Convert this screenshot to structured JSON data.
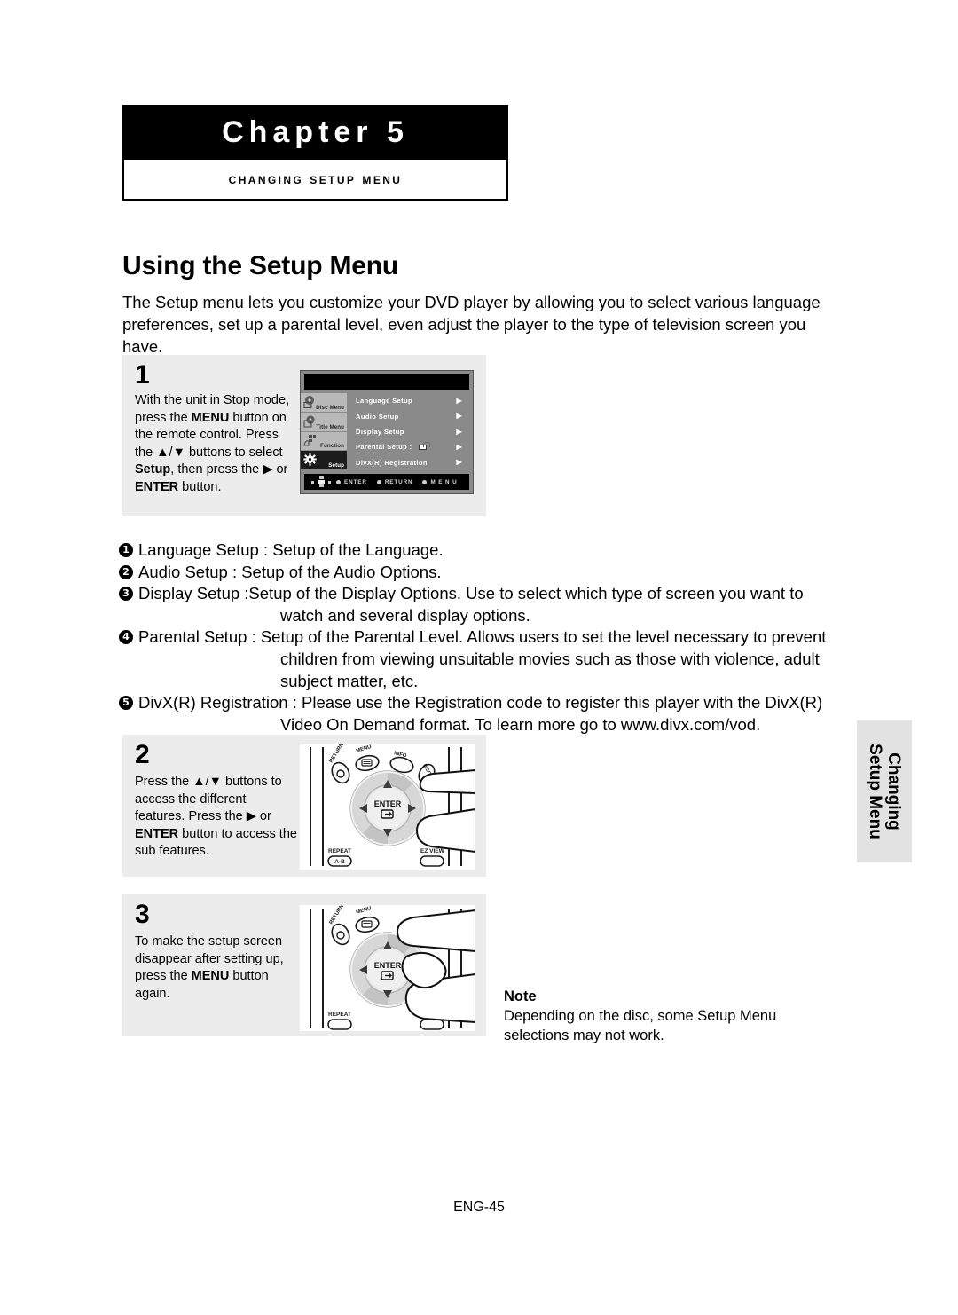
{
  "chapter": {
    "heading": "Chapter 5",
    "subheading": "Changing Setup Menu"
  },
  "page": {
    "title": "Using the Setup Menu",
    "intro": "The Setup menu lets you customize your DVD player by allowing you to select various language preferences, set up a parental level, even adjust the player to the type of television screen you have.",
    "footer": "ENG-45",
    "side_tab": "Changing\nSetup Menu"
  },
  "steps": [
    {
      "number": "1",
      "text_parts": [
        {
          "t": "With the unit in Stop mode, press the ",
          "b": false
        },
        {
          "t": "MENU",
          "b": true
        },
        {
          "t": " button on the remote control.",
          "b": false
        },
        {
          "t": "\nPress the ▲/▼ buttons to select ",
          "b": false
        },
        {
          "t": "Setup",
          "b": true
        },
        {
          "t": ", then press the ▶ or ",
          "b": false
        },
        {
          "t": "ENTER",
          "b": true
        },
        {
          "t": " button.",
          "b": false
        }
      ]
    },
    {
      "number": "2",
      "text_parts": [
        {
          "t": "Press the ▲/▼ buttons to access the different features. Press the ▶ or ",
          "b": false
        },
        {
          "t": "ENTER",
          "b": true
        },
        {
          "t": " button to access the sub features.",
          "b": false
        }
      ]
    },
    {
      "number": "3",
      "text_parts": [
        {
          "t": "To make the setup screen disappear after setting up, press the ",
          "b": false
        },
        {
          "t": "MENU",
          "b": true
        },
        {
          "t": " button again.",
          "b": false
        }
      ]
    }
  ],
  "osd": {
    "sidebar": [
      {
        "label": "Disc Menu",
        "icon": "disc-menu-icon",
        "active": false
      },
      {
        "label": "Title Menu",
        "icon": "title-menu-icon",
        "active": false
      },
      {
        "label": "Function",
        "icon": "function-icon",
        "active": false
      },
      {
        "label": "Setup",
        "icon": "gear-icon",
        "active": true
      }
    ],
    "items": [
      {
        "label": "Language Setup",
        "lock": false,
        "arrow": "▶"
      },
      {
        "label": "Audio Setup",
        "lock": false,
        "arrow": "▶"
      },
      {
        "label": "Display Setup",
        "lock": false,
        "arrow": "▶"
      },
      {
        "label": "Parental Setup :",
        "lock": true,
        "arrow": "▶"
      },
      {
        "label": "DivX(R) Registration",
        "lock": false,
        "arrow": "▶"
      }
    ],
    "bottom_keys": [
      "ENTER",
      "RETURN",
      "M E N U"
    ]
  },
  "remote": {
    "buttons": {
      "return": "RETURN",
      "menu": "MENU",
      "info": "INFO",
      "disc_menu": "DISC MENU",
      "enter": "ENTER",
      "repeat": "REPEAT",
      "repeat_sub": "A-B",
      "ez_view": "EZ VIEW"
    }
  },
  "definitions": [
    {
      "num": "❶",
      "main": "Language Setup : Setup of the Language.",
      "cont": ""
    },
    {
      "num": "❷",
      "main": "Audio Setup : Setup of the Audio Options.",
      "cont": ""
    },
    {
      "num": "❸",
      "main": "Display Setup :Setup of the Display Options. Use to select which type of screen you want to",
      "cont": "watch and several display options."
    },
    {
      "num": "❹",
      "main": "Parental Setup : Setup of the Parental Level. Allows users to set the level necessary to prevent",
      "cont": "children from viewing unsuitable movies such as those with violence, adult subject matter, etc."
    },
    {
      "num": "❺",
      "main": "DivX(R) Registration :  Please use the Registration code to register this player with the DivX(R)",
      "cont": "Video On Demand format. To learn more go to www.divx.com/vod."
    }
  ],
  "note": {
    "title": "Note",
    "text": "Depending on the disc, some Setup Menu selections may not work."
  }
}
